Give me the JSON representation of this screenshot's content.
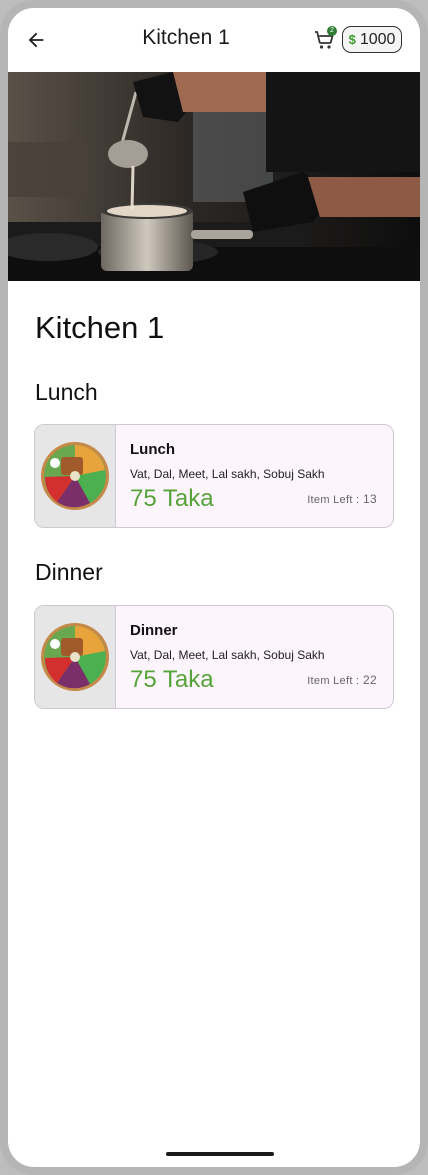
{
  "app_bar": {
    "title": "Kitchen 1",
    "cart_count": "2",
    "coin_balance": "1000"
  },
  "kitchen": {
    "name": "Kitchen 1"
  },
  "sections": [
    {
      "title": "Lunch",
      "meal": {
        "name": "Lunch",
        "items": "Vat, Dal, Meet, Lal sakh, Sobuj Sakh",
        "price": "75 Taka",
        "items_left_label": "Item Left :",
        "items_left": "13"
      }
    },
    {
      "title": "Dinner",
      "meal": {
        "name": "Dinner",
        "items": "Vat, Dal, Meet, Lal sakh, Sobuj Sakh",
        "price": "75 Taka",
        "items_left_label": "Item Left :",
        "items_left": "22"
      }
    }
  ],
  "colors": {
    "price_green": "#56a33a",
    "card_background": "#fcf5fc",
    "coin_icon": "#3a9d2a"
  },
  "icons": {
    "back": "arrow-left-icon",
    "cart": "shopping-cart-icon",
    "coin": "coin-icon"
  }
}
